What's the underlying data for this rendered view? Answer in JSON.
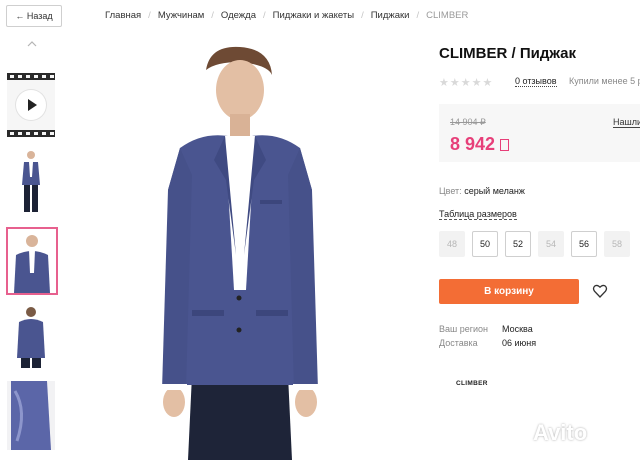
{
  "nav": {
    "back_label": "← Назад"
  },
  "breadcrumb": {
    "items": [
      "Главная",
      "Мужчинам",
      "Одежда",
      "Пиджаки и жакеты",
      "Пиджаки"
    ],
    "current": "CLIMBER",
    "separator": "/"
  },
  "product": {
    "title": "CLIMBER / Пиджак",
    "rating_stars": "★★★★★",
    "reviews_label": "0 отзывов",
    "bought_label": "Купили менее 5 р",
    "old_price": "14 904 ₽",
    "price": "8 942",
    "found_cheaper_label": "Нашли",
    "color_label": "Цвет:",
    "color_value": "серый меланж",
    "size_table_label": "Таблица размеров",
    "sizes": [
      {
        "label": "48",
        "available": false
      },
      {
        "label": "50",
        "available": true
      },
      {
        "label": "52",
        "available": true
      },
      {
        "label": "54",
        "available": false
      },
      {
        "label": "56",
        "available": true
      },
      {
        "label": "58",
        "available": false
      }
    ],
    "cart_button_label": "В корзину",
    "region_label": "Ваш регион",
    "region_value": "Москва",
    "delivery_label": "Доставка",
    "delivery_value": "06 июня",
    "brand_logo_text": "CLIMBER"
  },
  "watermark": {
    "text": "Avito"
  },
  "colors": {
    "accent_price": "#e73f79",
    "cart_button": "#f36d35",
    "selected_thumb_border": "#e7608e",
    "blazer": "#4a5590"
  },
  "icons": [
    "chevron-up-icon",
    "play-icon",
    "heart-icon",
    "currency-icon"
  ]
}
